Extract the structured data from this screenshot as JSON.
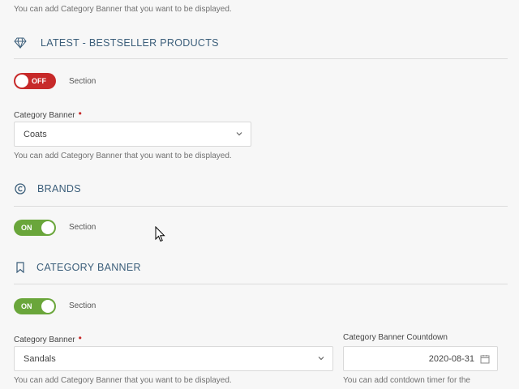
{
  "top_help": "You can add Category Banner that you want to be displayed.",
  "latest": {
    "title": "LATEST - BESTSELLER PRODUCTS",
    "toggle_state": "OFF",
    "toggle_caption": "Section",
    "field_label": "Category Banner",
    "required_mark": "•",
    "select_value": "Coats",
    "help": "You can add Category Banner that you want to be displayed."
  },
  "brands": {
    "title": "BRANDS",
    "toggle_state": "ON",
    "toggle_caption": "Section"
  },
  "category_banner": {
    "title": "CATEGORY BANNER",
    "toggle_state": "ON",
    "toggle_caption": "Section",
    "field_label": "Category Banner",
    "required_mark": "•",
    "select_value": "Sandals",
    "help": "You can add Category Banner that you want to be displayed.",
    "countdown_label": "Category Banner Countdown",
    "countdown_value": "2020-08-31",
    "countdown_help": "You can add contdown timer for the"
  },
  "colors": {
    "accent_title": "#3b5e7a",
    "toggle_on": "#6aa63b",
    "toggle_off": "#c72a2a",
    "required": "#c72a2a"
  },
  "icons": {
    "latest": "diamond-icon",
    "brands": "copyright-icon",
    "category_banner": "bookmark-icon",
    "select": "chevron-down-icon",
    "date": "calendar-icon"
  }
}
